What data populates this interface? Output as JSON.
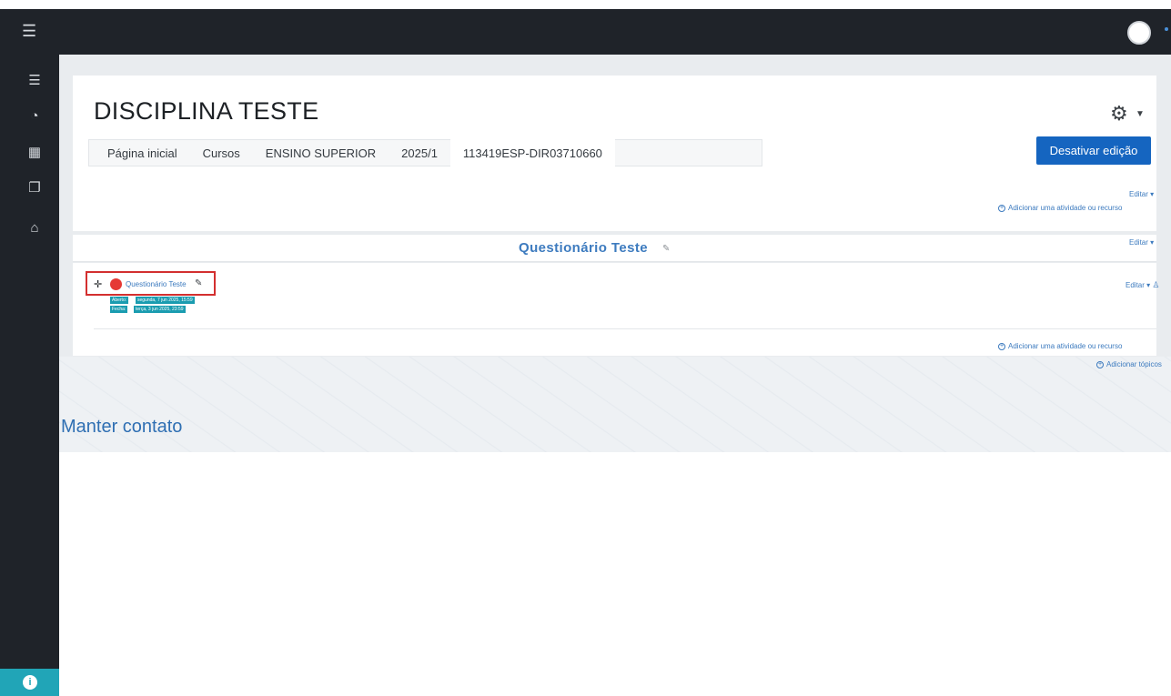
{
  "topbar": {
    "menu_icon": "hamburger-icon",
    "avatar_icon": "user-avatar-icon"
  },
  "sidebar": {
    "items": [
      {
        "icon": "list-icon",
        "glyph": "☰"
      },
      {
        "icon": "dashboard-icon",
        "glyph": "◔"
      },
      {
        "icon": "calendar-icon",
        "glyph": "▦"
      },
      {
        "icon": "files-icon",
        "glyph": "❐"
      },
      {
        "icon": "graduation-cap-icon",
        "glyph": "⌂"
      }
    ],
    "bottom_icon": "accessibility-icon"
  },
  "page": {
    "title": "DISCIPLINA TESTE",
    "settings_icon": "gear-icon",
    "edit_toggle_label": "Desativar edição"
  },
  "breadcrumb": {
    "items": [
      "Página inicial",
      "Cursos",
      "ENSINO SUPERIOR",
      "2025/1",
      "113419ESP-DIR03710660"
    ]
  },
  "section0": {
    "edit_label": "Editar ▾",
    "add_activity_label": "Adicionar uma atividade ou recurso"
  },
  "section1": {
    "title": "Questionário Teste",
    "edit_label": "Editar ▾",
    "activity": {
      "name": "Questionário Teste",
      "opens_label": "Aberto:",
      "opens_date": "segunda, 7 jun 2025, 15:59",
      "closes_label": "Fecha:",
      "closes_date": "terça, 3 jun 2025, 23:59",
      "edit_label": "Editar ▾"
    },
    "add_activity_label": "Adicionar uma atividade ou recurso",
    "add_topics_label": "Adicionar tópicos"
  },
  "footer": {
    "contact_title": "Manter contato"
  },
  "colors": {
    "primary": "#1565c0",
    "sidebar": "#1f2329",
    "link": "#3d7bbf",
    "accent_teal": "#21a5b7",
    "highlight_red": "#d32f2f"
  }
}
